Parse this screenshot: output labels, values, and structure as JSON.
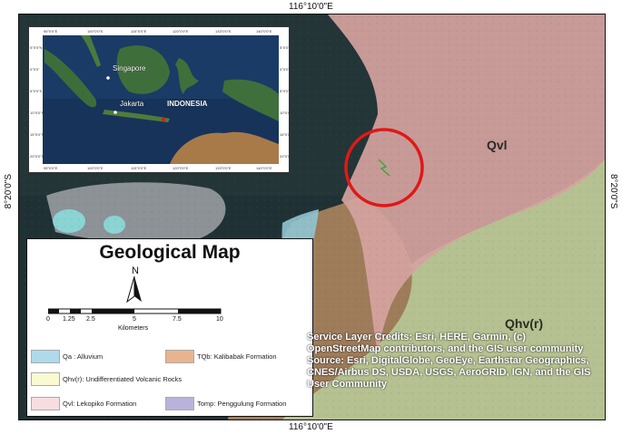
{
  "coordinates": {
    "top_longitude": "116°10'0\"E",
    "bottom_longitude": "116°10'0\"E",
    "left_latitude": "8°20'0\"S",
    "right_latitude": "8°20'0\"S"
  },
  "map_units": {
    "qvl": "Qvl",
    "qhv": "Qhv(r)"
  },
  "colors": {
    "qvl": "#d6a39f",
    "qhv": "#c6d2a3",
    "tqb": "#c8875a",
    "alluvium": "#aedaea",
    "sea": "#1f3134",
    "highlight_circle": "#e01818"
  },
  "inset": {
    "places": [
      "Singapore",
      "Jakarta",
      "INDONESIA"
    ],
    "top_ticks": [
      "95°0'0\"E",
      "100°0'0\"E",
      "115°0'0\"E",
      "120°0'0\"E",
      "133°0'0\"E",
      "140°0'0\"E"
    ],
    "bottom_ticks": [
      "95°0'0\"E",
      "100°0'0\"E",
      "115°0'0\"E",
      "120°0'0\"E",
      "133°0'0\"E",
      "140°0'0\"E"
    ],
    "left_ticks": [
      "5°0'0\"N",
      "0°0'0\"",
      "5°0'0\"S",
      "10°0'0\"S",
      "15°0'0\"S",
      "20°0'0\"S"
    ],
    "right_ticks": [
      "5°0'0\"N",
      "0°0'0\"",
      "5°0'0\"S",
      "10°0'0\"S",
      "15°0'0\"S",
      "20°0'0\"S"
    ]
  },
  "legend": {
    "title": "Geological Map",
    "north": "N",
    "scale_labels": [
      "0",
      "1.25",
      "2.5",
      "5",
      "7.5",
      "10"
    ],
    "scale_units": "Kilometers",
    "items": [
      {
        "label": "Qa : Alluvium",
        "color": "#aedaea"
      },
      {
        "label": "TQb: Kalibabak Formation",
        "color": "#e8b48e"
      },
      {
        "label": "Qhv(r): Undifferentiated Volcanic Rocks",
        "color": "#fbf9d2"
      },
      {
        "label": "Qvl: Lekopiko Formation",
        "color": "#f8dde0"
      },
      {
        "label": "Tomp: Penggulung Formation",
        "color": "#b9b3dc"
      }
    ]
  },
  "credits": {
    "service": "Service Layer Credits: Esri, HERE, Garmin, (c) OpenStreetMap contributors, and the GIS user community",
    "source": "Source: Esri, DigitalGlobe, GeoEye, Earthstar Geographics, CNES/Airbus DS, USDA, USGS, AeroGRID, IGN, and the GIS User Community"
  }
}
